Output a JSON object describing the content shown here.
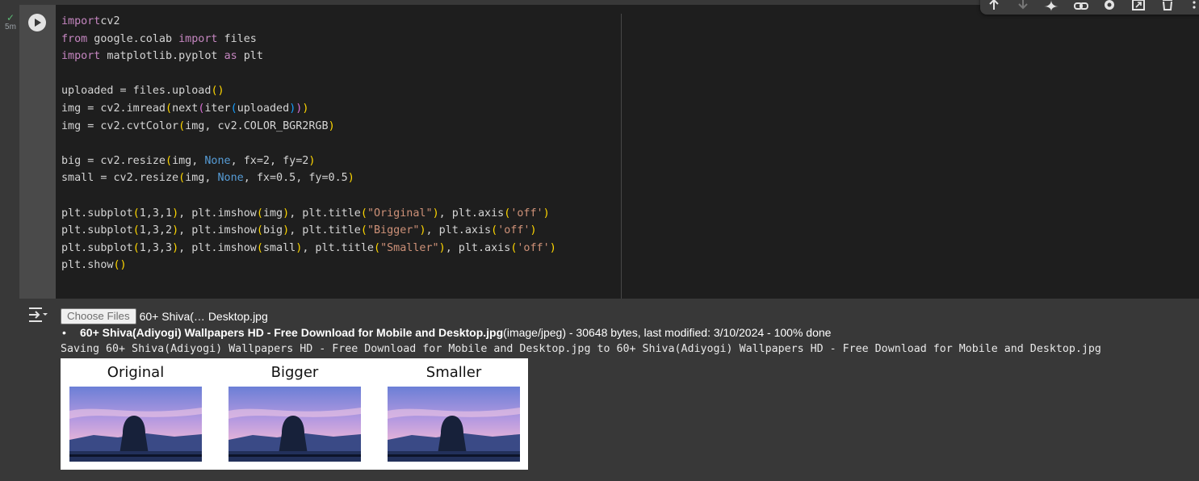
{
  "cell": {
    "exec_time": "5m",
    "code_lines": [
      [
        [
          "kw",
          "import"
        ],
        [
          "",
          "cv2"
        ]
      ],
      [
        [
          "kw",
          "from"
        ],
        [
          "",
          " google.colab "
        ],
        [
          "kw",
          "import"
        ],
        [
          "",
          " files"
        ]
      ],
      [
        [
          "kw",
          "import"
        ],
        [
          "",
          " matplotlib.pyplot "
        ],
        [
          "kw",
          "as"
        ],
        [
          "",
          " plt"
        ]
      ],
      [],
      [
        [
          "",
          "uploaded = files.upload"
        ],
        [
          "b1",
          "()"
        ]
      ],
      [
        [
          "",
          "img = cv2.imread"
        ],
        [
          "b1",
          "("
        ],
        [
          "",
          "next"
        ],
        [
          "b2",
          "("
        ],
        [
          "",
          "iter"
        ],
        [
          "b3",
          "("
        ],
        [
          "",
          "uploaded"
        ],
        [
          "b3",
          ")"
        ],
        [
          "b2",
          ")"
        ],
        [
          "b1",
          ")"
        ]
      ],
      [
        [
          "",
          "img = cv2.cvtColor"
        ],
        [
          "b1",
          "("
        ],
        [
          "",
          "img, cv2.COLOR_BGR2RGB"
        ],
        [
          "b1",
          ")"
        ]
      ],
      [],
      [
        [
          "",
          "big = cv2.resize"
        ],
        [
          "b1",
          "("
        ],
        [
          "",
          "img, "
        ],
        [
          "n",
          "None"
        ],
        [
          "",
          ", fx=2, fy=2"
        ],
        [
          "b1",
          ")"
        ]
      ],
      [
        [
          "",
          "small = cv2.resize"
        ],
        [
          "b1",
          "("
        ],
        [
          "",
          "img, "
        ],
        [
          "n",
          "None"
        ],
        [
          "",
          ", fx=0.5, fy=0.5"
        ],
        [
          "b1",
          ")"
        ]
      ],
      [],
      [
        [
          "",
          "plt.subplot"
        ],
        [
          "b1",
          "("
        ],
        [
          "",
          "1,3,1"
        ],
        [
          "b1",
          ")"
        ],
        [
          "",
          ", plt.imshow"
        ],
        [
          "b1",
          "("
        ],
        [
          "",
          "img"
        ],
        [
          "b1",
          ")"
        ],
        [
          "",
          ", plt.title"
        ],
        [
          "b1",
          "("
        ],
        [
          "s",
          "\"Original\""
        ],
        [
          "b1",
          ")"
        ],
        [
          "",
          ", plt.axis"
        ],
        [
          "b1",
          "("
        ],
        [
          "s",
          "'off'"
        ],
        [
          "b1",
          ")"
        ]
      ],
      [
        [
          "",
          "plt.subplot"
        ],
        [
          "b1",
          "("
        ],
        [
          "",
          "1,3,2"
        ],
        [
          "b1",
          ")"
        ],
        [
          "",
          ", plt.imshow"
        ],
        [
          "b1",
          "("
        ],
        [
          "",
          "big"
        ],
        [
          "b1",
          ")"
        ],
        [
          "",
          ", plt.title"
        ],
        [
          "b1",
          "("
        ],
        [
          "s",
          "\"Bigger\""
        ],
        [
          "b1",
          ")"
        ],
        [
          "",
          ", plt.axis"
        ],
        [
          "b1",
          "("
        ],
        [
          "s",
          "'off'"
        ],
        [
          "b1",
          ")"
        ]
      ],
      [
        [
          "",
          "plt.subplot"
        ],
        [
          "b1",
          "("
        ],
        [
          "",
          "1,3,3"
        ],
        [
          "b1",
          ")"
        ],
        [
          "",
          ", plt.imshow"
        ],
        [
          "b1",
          "("
        ],
        [
          "",
          "small"
        ],
        [
          "b1",
          ")"
        ],
        [
          "",
          ", plt.title"
        ],
        [
          "b1",
          "("
        ],
        [
          "s",
          "\"Smaller\""
        ],
        [
          "b1",
          ")"
        ],
        [
          "",
          ", plt.axis"
        ],
        [
          "b1",
          "("
        ],
        [
          "s",
          "'off'"
        ],
        [
          "b1",
          ")"
        ]
      ],
      [
        [
          "",
          "plt.show"
        ],
        [
          "b1",
          "()"
        ]
      ]
    ]
  },
  "toolbar": {
    "icons": [
      "move-up-icon",
      "move-down-icon",
      "gemini-spark-icon",
      "link-icon",
      "gear-icon",
      "mirror-cell-icon",
      "delete-icon",
      "more-icon"
    ]
  },
  "output": {
    "choose_files_label": "Choose Files",
    "selected_file": "60+ Shiva(… Desktop.jpg",
    "upload": {
      "filename": "60+ Shiva(Adiyogi) Wallpapers HD - Free Download for Mobile and Desktop.jpg",
      "details": "(image/jpeg) - 30648 bytes, last modified: 3/10/2024 - 100% done"
    },
    "saving_line": "Saving 60+ Shiva(Adiyogi) Wallpapers HD - Free Download for Mobile and Desktop.jpg to 60+ Shiva(Adiyogi) Wallpapers HD - Free Download for Mobile and Desktop.jpg",
    "figure": {
      "titles": [
        "Original",
        "Bigger",
        "Smaller"
      ]
    }
  },
  "colors": {
    "background": "#383838",
    "editor": "#1e1e1e",
    "keyword": "#c586c0",
    "none": "#569cd6",
    "string": "#ce9178",
    "bracket_1": "#ffd700",
    "bracket_2": "#da70d6",
    "bracket_3": "#179fff"
  }
}
